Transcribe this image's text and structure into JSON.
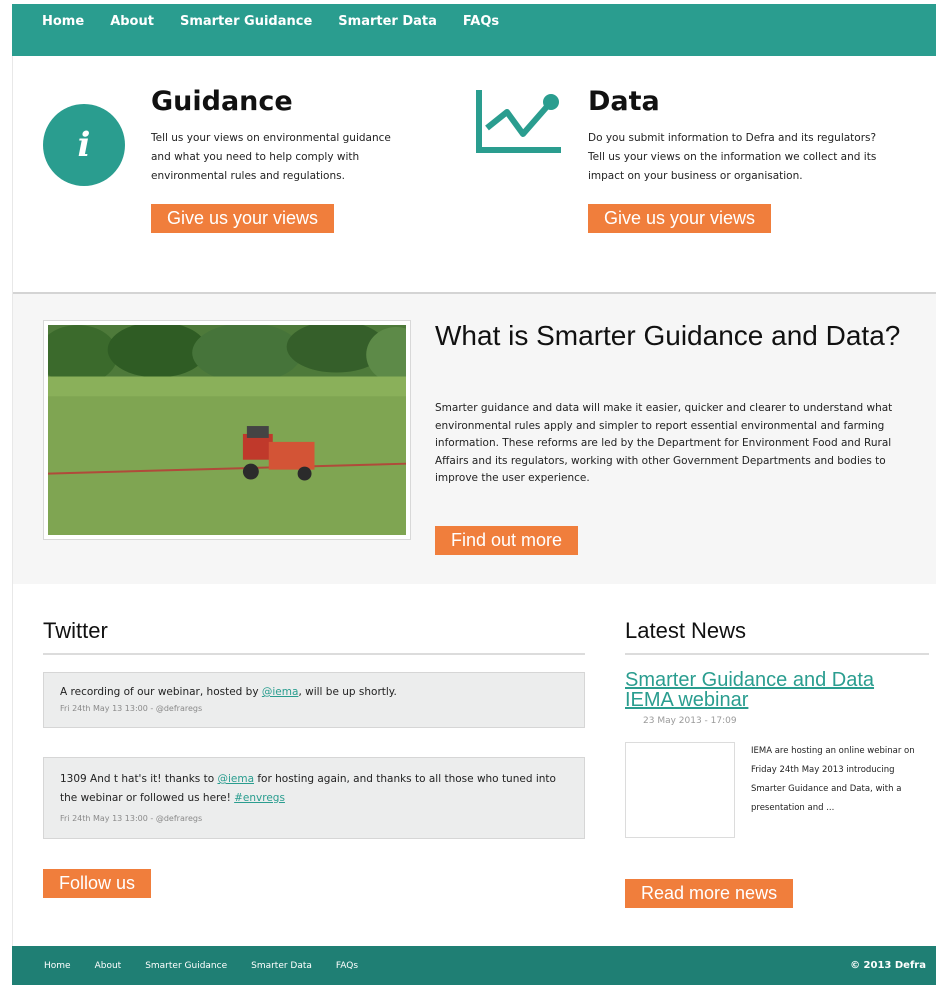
{
  "nav": [
    "Home",
    "About",
    "Smarter Guidance",
    "Smarter Data",
    "FAQs"
  ],
  "guidance": {
    "title": "Guidance",
    "icon": "info-icon",
    "text": "Tell us your views on environmental guidance and what you need to help comply with environmental rules and regulations.",
    "button": "Give us your views"
  },
  "data_block": {
    "title": "Data",
    "icon": "line-chart-icon",
    "text": "Do you submit information to Defra and its regulators? Tell us your views on the information we collect and its impact on your business or organisation.",
    "button": "Give us your views"
  },
  "whatis": {
    "title": "What is Smarter Guidance and Data?",
    "image": "tractor-field-photo",
    "text": "Smarter guidance and data will make it easier, quicker and clearer to understand what environmental rules apply and simpler to report essential environmental and farming information. These reforms are led by the Department for Environment Food and Rural Affairs and its regulators, working with other Government Departments and bodies to improve the user experience.",
    "button": "Find out more"
  },
  "twitter": {
    "title": "Twitter",
    "tweets": [
      {
        "text_before": "A recording of our webinar, hosted by ",
        "link": "@iema",
        "text_after": ", will be up shortly.",
        "meta": "Fri 24th May 13 13:00 - @defraregs"
      },
      {
        "text_before": "1309 And t  hat's it! thanks to ",
        "link": "@iema",
        "text_after": " for hosting again, and thanks to all those who tuned into the webinar or followed us here! ",
        "hashtag": "#envregs",
        "meta": "Fri 24th May 13 13:00 - @defraregs"
      }
    ],
    "button": "Follow us"
  },
  "news": {
    "title": "Latest News",
    "item_title": "Smarter Guidance and Data IEMA webinar",
    "date": "23 May 2013 - 17:09",
    "excerpt": "IEMA are hosting an online webinar on Friday 24th May 2013 introducing Smarter Guidance and Data, with a presentation and ...",
    "button": "Read more news"
  },
  "footer": {
    "nav": [
      "Home",
      "About",
      "Smarter Guidance",
      "Smarter Data",
      "FAQs"
    ],
    "copyright": "© 2013 Defra"
  },
  "colors": {
    "teal": "#2a9d8f",
    "orange": "#f07e3c",
    "footer": "#1f7f74"
  }
}
